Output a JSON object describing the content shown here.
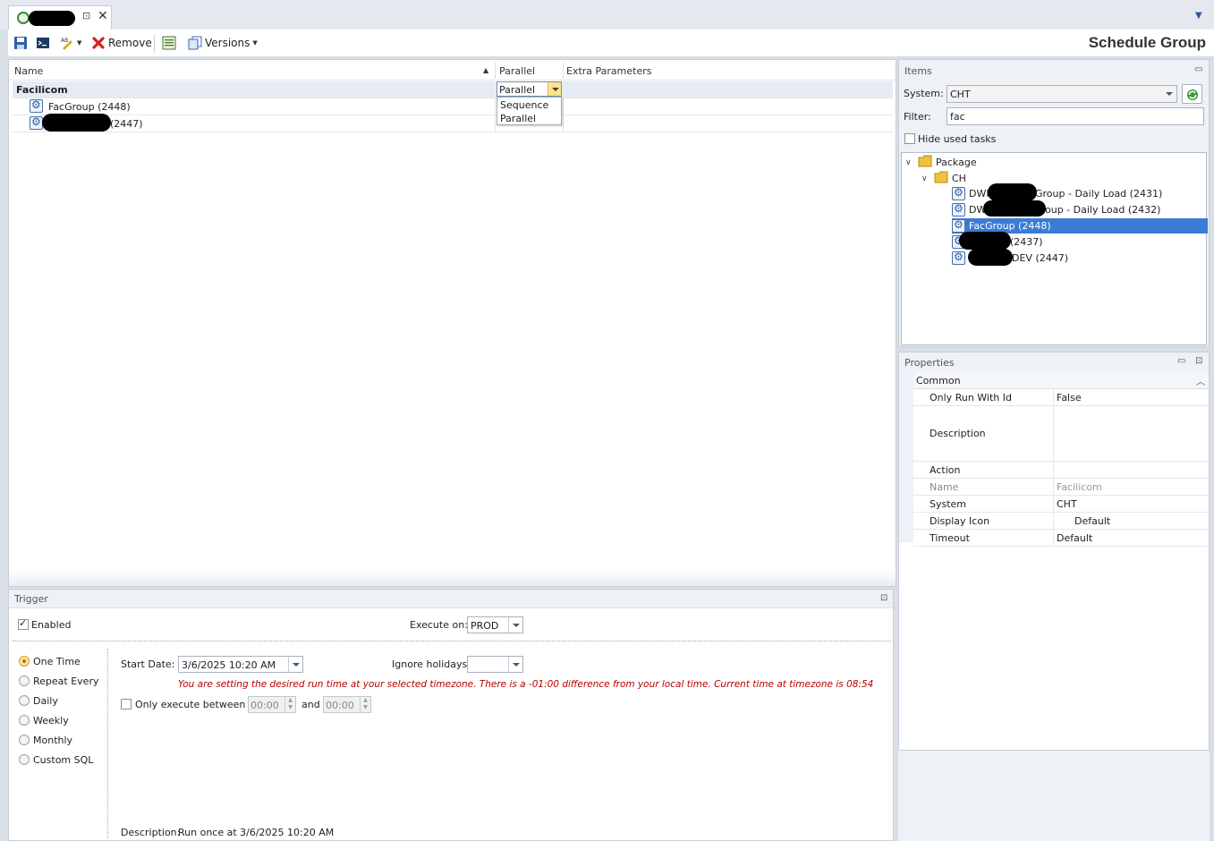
{
  "doc_tab": {
    "pin": "⊡",
    "close": "✕"
  },
  "toolbar": {
    "remove_label": "Remove",
    "versions_label": "Versions",
    "page_title": "Schedule Group"
  },
  "grid": {
    "columns": [
      "Name",
      "Parallel",
      "Extra Parameters"
    ],
    "group": {
      "name": "Facilicom",
      "parallel": "Parallel"
    },
    "rows": [
      {
        "name": "FacGroup (2448)"
      },
      {
        "name": "(2447)"
      }
    ],
    "parallel_options": [
      "Sequence",
      "Parallel"
    ]
  },
  "trigger": {
    "title": "Trigger",
    "enabled_label": "Enabled",
    "execute_on_label": "Execute on:",
    "execute_on_value": "PROD",
    "modes": [
      "One Time",
      "Repeat Every",
      "Daily",
      "Weekly",
      "Monthly",
      "Custom SQL"
    ],
    "selected_mode": "One Time",
    "start_date_label": "Start Date:",
    "start_date_value": "3/6/2025 10:20 AM",
    "ignore_holidays_label": "Ignore holidays:",
    "warning": "You are setting the desired run time at your selected timezone. There is a -01:00 difference from your local time. Current time at timezone is 08:54",
    "only_execute_label": "Only execute between",
    "time_from": "00:00",
    "and_label": "and",
    "time_to": "00:00",
    "description_label": "Description:",
    "description_value": "Run once at 3/6/2025 10:20 AM"
  },
  "items": {
    "title": "Items",
    "system_label": "System:",
    "system_value": "CHT",
    "filter_label": "Filter:",
    "filter_value": "fac",
    "hide_used_label": "Hide used tasks",
    "tree": {
      "root": "Package",
      "folder": "CH",
      "children": [
        {
          "pre": "DWH",
          "post": "Group - Daily Load (2431)"
        },
        {
          "pre": "DW",
          "post": "oup - Daily Load (2432)"
        },
        {
          "pre": "",
          "post": "FacGroup (2448)"
        },
        {
          "pre": "",
          "post": "(2437)"
        },
        {
          "pre": "",
          "post": "DEV (2447)"
        }
      ]
    }
  },
  "properties": {
    "title": "Properties",
    "section_common": "Common",
    "rows": [
      {
        "key": "Only Run With Id",
        "value": "False"
      },
      {
        "key": "Description",
        "value": ""
      },
      {
        "key": "Action",
        "value": ""
      },
      {
        "key": "Name",
        "value": "Facilicom"
      },
      {
        "key": "System",
        "value": "CHT"
      },
      {
        "key": "Display Icon",
        "value": "Default"
      },
      {
        "key": "Timeout",
        "value": "Default"
      }
    ]
  },
  "colors": {
    "accent": "#3a7bd5",
    "warning": "#b80000",
    "selection": "#3a7bd5"
  }
}
